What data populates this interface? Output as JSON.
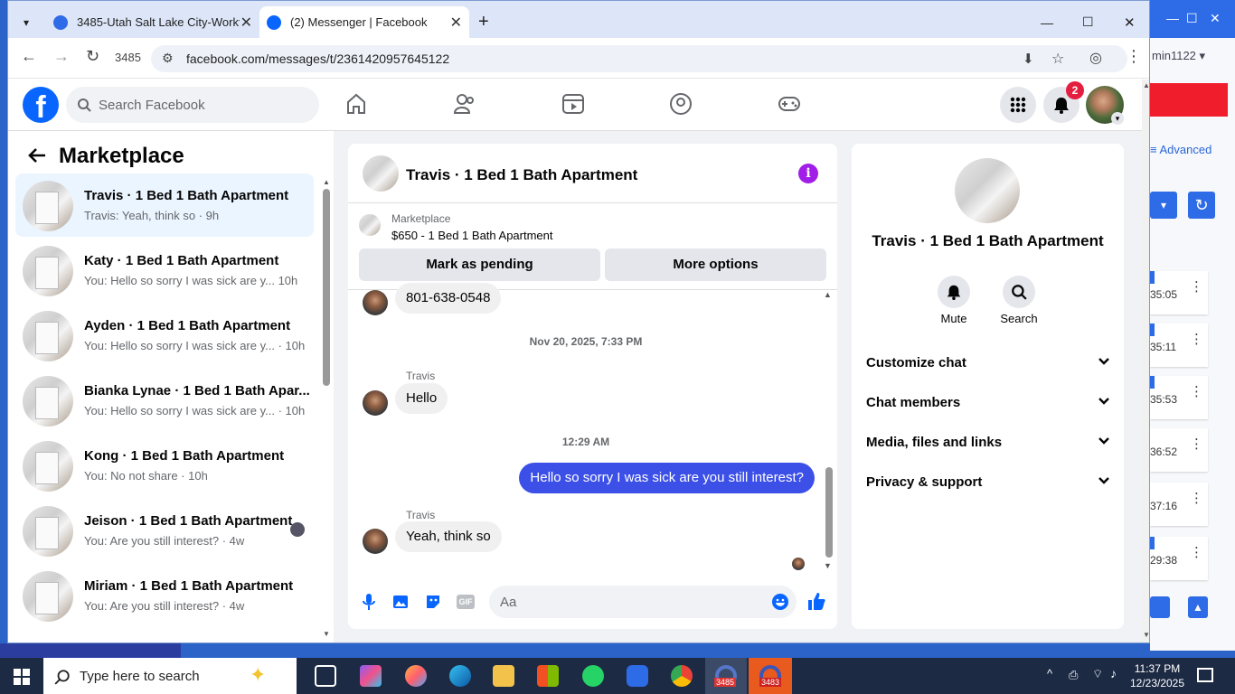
{
  "browser": {
    "tabs": [
      {
        "title": "3485-Utah Salt Lake City-Workt",
        "active": false
      },
      {
        "title": "(2) Messenger | Facebook",
        "active": true
      }
    ],
    "profile_label": "3485",
    "url": "facebook.com/messages/t/2361420957645122"
  },
  "background_window": {
    "user": "min1122 ▾",
    "advanced": "Advanced",
    "times": [
      "35:05",
      "35:11",
      "35:53",
      "36:52",
      "37:16",
      "29:38"
    ]
  },
  "fb": {
    "search_placeholder": "Search Facebook",
    "notification_count": "2"
  },
  "left_panel": {
    "title": "Marketplace",
    "conversations": [
      {
        "name": "Travis · 1 Bed 1 Bath Apartment",
        "preview": "Travis: Yeah, think so · 9h"
      },
      {
        "name": "Katy · 1 Bed 1 Bath Apartment",
        "preview": "You: Hello so sorry I was sick are y...  10h"
      },
      {
        "name": "Ayden · 1 Bed 1 Bath Apartment",
        "preview": "You: Hello so sorry I was sick are y... · 10h"
      },
      {
        "name": "Bianka Lynae · 1 Bed 1 Bath Apar...",
        "preview": "You: Hello so sorry I was sick are y... · 10h"
      },
      {
        "name": "Kong · 1 Bed 1 Bath Apartment",
        "preview": "You: No not share · 10h"
      },
      {
        "name": "Jeison · 1 Bed 1 Bath Apartment",
        "preview": "You: Are you still interest? · 4w"
      },
      {
        "name": "Miriam · 1 Bed 1 Bath Apartment",
        "preview": "You: Are you still interest? · 4w"
      }
    ]
  },
  "chat": {
    "title": "Travis · 1 Bed 1 Bath Apartment",
    "listing_source": "Marketplace",
    "listing_title": "$650 - 1 Bed 1 Bath Apartment",
    "mark_pending": "Mark as pending",
    "more_options": "More options",
    "messages": [
      {
        "text": "801-638-0548"
      },
      {
        "stamp": "Nov 20, 2025, 7:33 PM"
      },
      {
        "sender": "Travis",
        "text": "Hello"
      },
      {
        "stamp": "12:29 AM"
      },
      {
        "text": "Hello so sorry I was sick are you still interest?"
      },
      {
        "sender": "Travis",
        "text": "Yeah, think so"
      }
    ],
    "composer_placeholder": "Aa"
  },
  "info_panel": {
    "title": "Travis · 1 Bed 1 Bath Apartment",
    "mute": "Mute",
    "search": "Search",
    "sections": [
      "Customize chat",
      "Chat members",
      "Media, files and links",
      "Privacy & support"
    ]
  },
  "taskbar": {
    "search_placeholder": "Type here to search",
    "time": "11:37 PM",
    "date": "12/23/2025",
    "badges": [
      "3485",
      "3483"
    ]
  },
  "colors": {
    "fb_blue": "#0866ff",
    "my_bubble": "#3c50e8",
    "badge_red": "#e41e3f",
    "info_purple": "#a01ee8"
  }
}
